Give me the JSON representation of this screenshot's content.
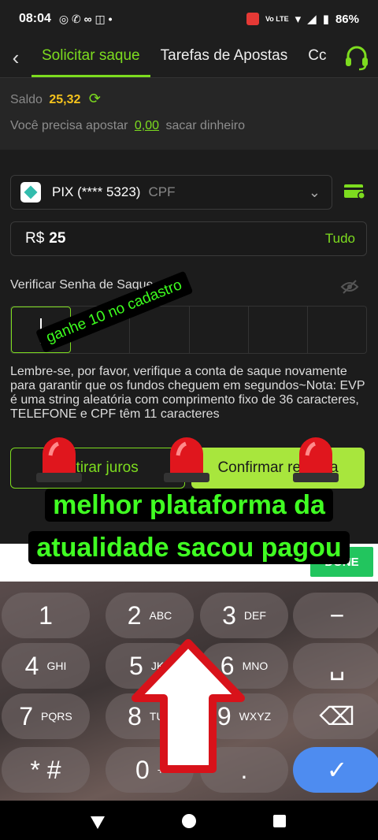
{
  "status_bar": {
    "time": "08:04",
    "network": "Vo LTE",
    "battery": "86%"
  },
  "nav": {
    "tabs": [
      {
        "label": "Solicitar saque",
        "active": true
      },
      {
        "label": "Tarefas de Apostas",
        "active": false
      },
      {
        "label": "Cc",
        "active": false
      }
    ]
  },
  "balance": {
    "label": "Saldo",
    "value": "25,32"
  },
  "bet_requirement": {
    "before": "Você precisa apostar",
    "amount": "0,00",
    "after": "sacar dinheiro"
  },
  "account": {
    "name": "PIX (**** 5323)",
    "type": "CPF"
  },
  "amount": {
    "currency": "R$",
    "value": "25",
    "all_label": "Tudo"
  },
  "password": {
    "label": "Verificar Senha de Saque"
  },
  "notice": "Lembre-se, por favor, verifique a conta de saque novamente para garantir que os fundos cheguem em segundos~Nota: EVP é uma string aleatória com comprimento fixo de 36 caracteres, TELEFONE e CPF têm 11 caracteres",
  "buttons": {
    "juros": "Retirar juros",
    "confirm": "Confirmar retirada"
  },
  "keyboard": {
    "done_label": "DONE",
    "keys": [
      {
        "n": "1",
        "l": ""
      },
      {
        "n": "2",
        "l": "ABC"
      },
      {
        "n": "3",
        "l": "DEF"
      },
      {
        "n": "−",
        "l": ""
      },
      {
        "n": "4",
        "l": "GHI"
      },
      {
        "n": "5",
        "l": "JKL"
      },
      {
        "n": "6",
        "l": "MNO"
      },
      {
        "n": "␣",
        "l": ""
      },
      {
        "n": "7",
        "l": "PQRS"
      },
      {
        "n": "8",
        "l": "TUV"
      },
      {
        "n": "9",
        "l": "WXYZ"
      },
      {
        "n": "⌫",
        "l": ""
      },
      {
        "n": "* #",
        "l": ""
      },
      {
        "n": "0",
        "l": "+"
      },
      {
        "n": ".",
        "l": ""
      },
      {
        "n": "✓",
        "l": ""
      }
    ]
  },
  "overlay": {
    "promo": "ganhe 10 no cadastro",
    "headline": "melhor plataforma da atualidade sacou pagou"
  },
  "colors": {
    "accent": "#7ddc1f",
    "balance": "#f4c21d",
    "overlay_text": "#40ff22"
  }
}
